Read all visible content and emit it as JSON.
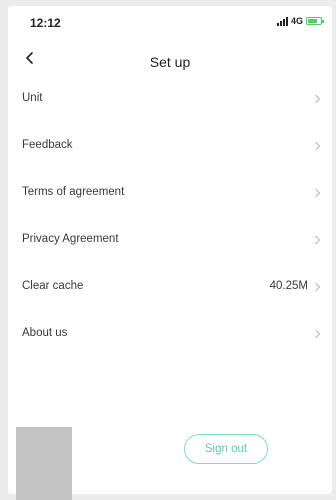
{
  "status_bar": {
    "time": "12:12",
    "network": "4G",
    "battery_color": "#5cc86a"
  },
  "header": {
    "title": "Set up",
    "back_icon": "chevron-left-icon"
  },
  "menu": {
    "items": [
      {
        "label": "Unit",
        "value": ""
      },
      {
        "label": "Feedback",
        "value": ""
      },
      {
        "label": "Terms of agreement",
        "value": ""
      },
      {
        "label": "Privacy Agreement",
        "value": ""
      },
      {
        "label": "Clear cache",
        "value": "40.25M"
      },
      {
        "label": "About us",
        "value": ""
      }
    ]
  },
  "footer": {
    "sign_out_label": "Sign out",
    "accent_color": "#5ec9ad"
  }
}
